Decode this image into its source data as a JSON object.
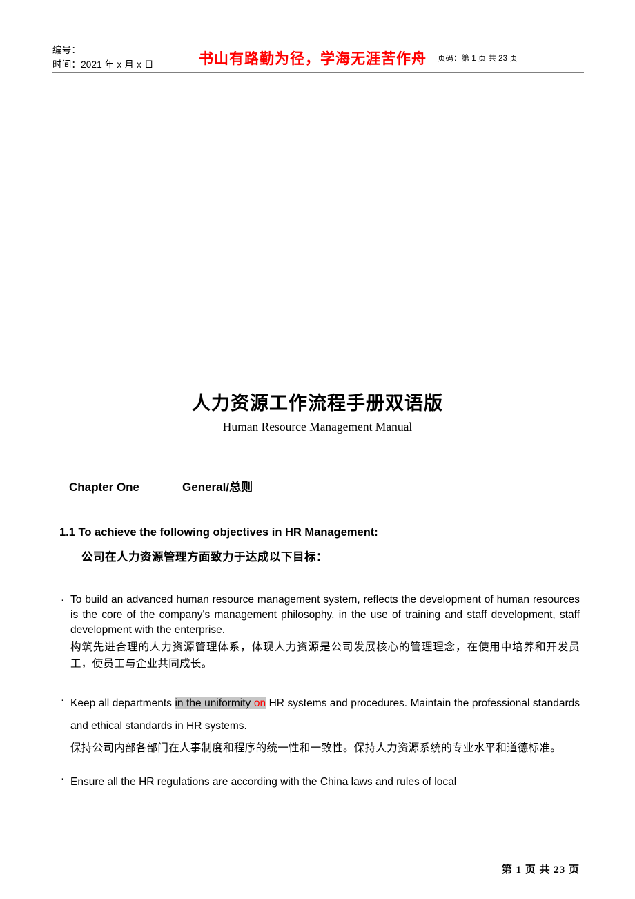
{
  "header": {
    "doc_number_label": "编号：",
    "date_label": "时间：2021 年 x 月 x 日",
    "slogan_line1": "书山有路勤为径，学海无涯苦作舟",
    "slogan_color": "#ff0000",
    "page_label": "页码：第 1 页  共 23 页"
  },
  "title": {
    "main": "人力资源工作流程手册双语版",
    "subtitle": "Human Resource Management Manual"
  },
  "chapter": {
    "number_label": "Chapter One",
    "name_label": "General/总则"
  },
  "section": {
    "number_en": "1.1 To achieve the following objectives in HR Management:",
    "number_zh": "公司在人力资源管理方面致力于达成以下目标："
  },
  "bullets": [
    {
      "marker": "·",
      "en": "To build an advanced human resource management system, reflects the development of human resources is the core of the company's management philosophy, in the use of training and staff development, staff development with the enterprise.",
      "zh": "构筑先进合理的人力资源管理体系，体现人力资源是公司发展核心的管理理念，在使用中培养和开发员工，使员工与企业共同成长。"
    },
    {
      "marker": "·",
      "en_pre": "Keep all departments ",
      "en_highlight_gray": "in the uniformity ",
      "en_highlight_red": "on",
      "en_post": " HR systems and procedures. Maintain the professional standards and ethical standards in HR systems.",
      "zh": "保持公司内部各部门在人事制度和程序的统一性和一致性。保持人力资源系统的专业水平和道德标准。"
    },
    {
      "marker": "·",
      "en": "Ensure all the HR regulations are according with the China laws and rules of local"
    }
  ],
  "footer": {
    "page_text": "第 1 页 共 23 页"
  },
  "colors": {
    "accent_red": "#ff0000",
    "highlight_gray": "#c6c6c6",
    "rule": "#808080"
  }
}
